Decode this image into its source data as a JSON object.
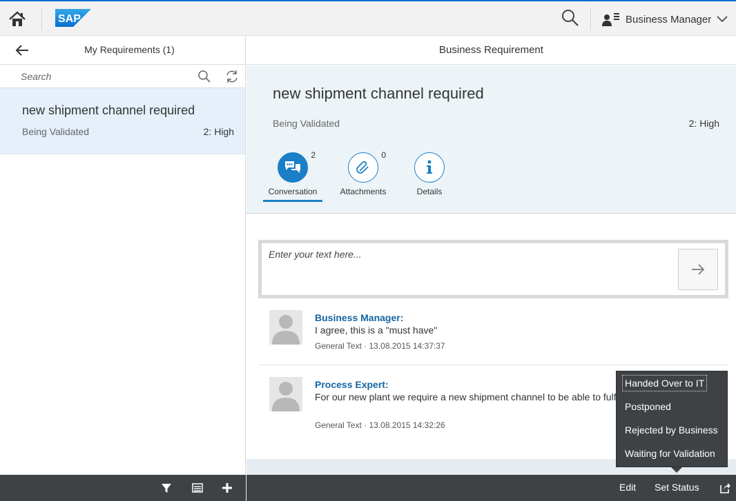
{
  "topbar": {
    "logo_text": "SAP",
    "user_name": "Business Manager"
  },
  "master": {
    "title": "My Requirements (1)",
    "search_placeholder": "Search",
    "items": [
      {
        "title": "new shipment channel required",
        "status": "Being Validated",
        "priority": "2: High"
      }
    ]
  },
  "detail": {
    "title": "Business Requirement",
    "object_title": "new shipment channel required",
    "status": "Being Validated",
    "priority": "2: High",
    "tabs": [
      {
        "label": "Conversation",
        "count": "2",
        "icon": "conversation-icon",
        "selected": true
      },
      {
        "label": "Attachments",
        "count": "0",
        "icon": "paperclip-icon",
        "selected": false
      },
      {
        "label": "Details",
        "count": "",
        "icon": "info-icon",
        "selected": false
      }
    ],
    "input_placeholder": "Enter your text here...",
    "feed": [
      {
        "sender": "Business Manager:",
        "text": "I agree, this is a \"must have\"",
        "meta": "General Text  ·  13.08.2015 14:37:37"
      },
      {
        "sender": "Process Expert:",
        "text": "For our new plant we require a new shipment channel to be able to fulfill our requirements.",
        "text_line2": "requirements.",
        "meta": "General Text  ·  13.08.2015 14:32:26"
      }
    ]
  },
  "footer": {
    "edit_label": "Edit",
    "set_status_label": "Set Status"
  },
  "status_popover": {
    "options": [
      "Handed Over to IT",
      "Postponed",
      "Rejected by Business",
      "Waiting for Validation"
    ]
  },
  "colors": {
    "accent": "#1a7fc6",
    "selected_item_bg": "#e5f0fa",
    "header_bg": "#edf4f8",
    "footer_bg": "#3f4245"
  }
}
